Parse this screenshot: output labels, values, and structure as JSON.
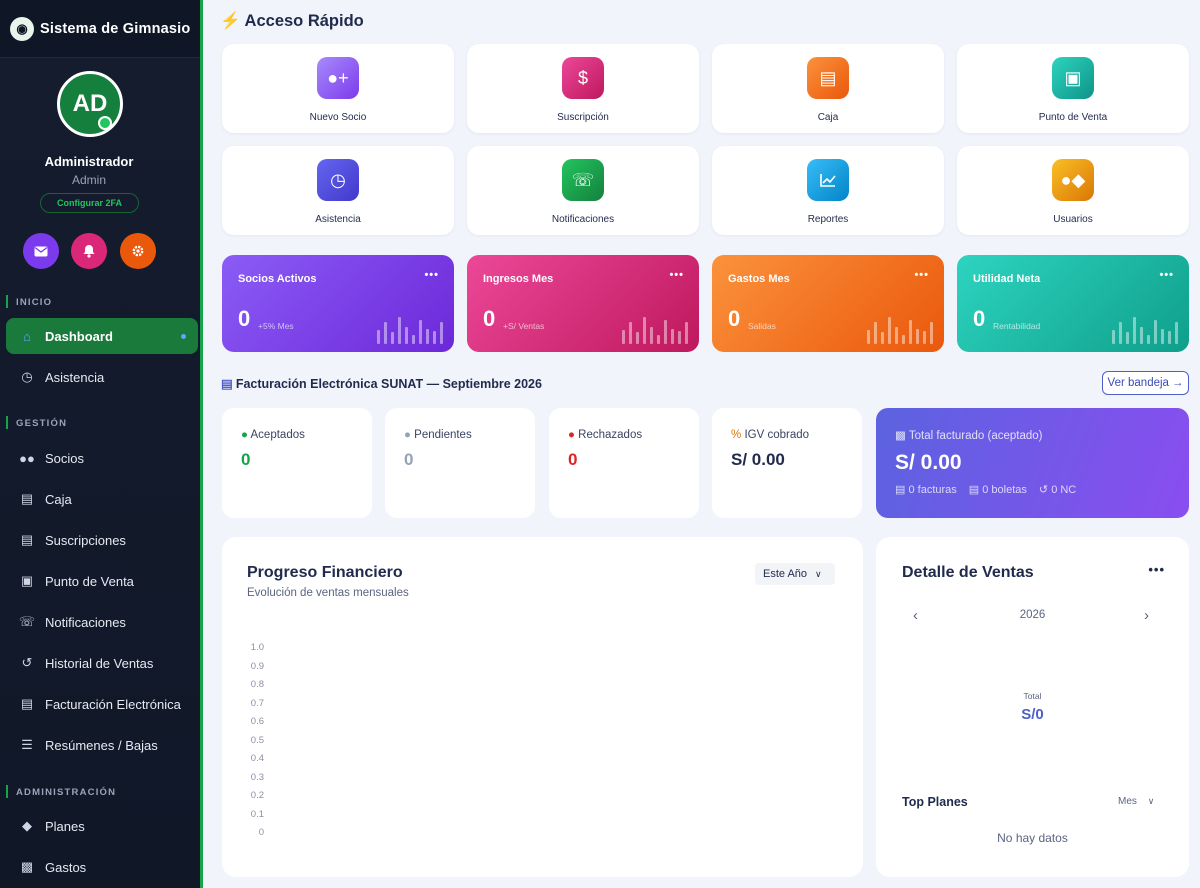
{
  "sidebar": {
    "app_name": "Sistema de Gimnasio",
    "logo_icon": "gym-logo-icon",
    "user": {
      "initials": "AD",
      "name": "Administrador",
      "role": "Admin",
      "twofa_label": "Configurar 2FA"
    },
    "quick_icons": [
      {
        "icon": "mail-icon",
        "color": "#7c3aed"
      },
      {
        "icon": "bell-icon",
        "color": "#db2777"
      },
      {
        "icon": "gear-icon",
        "color": "#ea580c"
      }
    ],
    "sections": {
      "inicio": "INICIO",
      "gestion": "GESTIÓN",
      "administracion": "ADMINISTRACIÓN"
    },
    "items": [
      {
        "label": "Dashboard",
        "icon": "home-icon",
        "active": true
      },
      {
        "label": "Asistencia",
        "icon": "clock-icon"
      },
      {
        "label": "Socios",
        "icon": "users-icon"
      },
      {
        "label": "Caja",
        "icon": "cash-register-icon"
      },
      {
        "label": "Suscripciones",
        "icon": "invoice-icon"
      },
      {
        "label": "Punto de Venta",
        "icon": "cart-icon"
      },
      {
        "label": "Notificaciones",
        "icon": "whatsapp-icon"
      },
      {
        "label": "Historial de Ventas",
        "icon": "history-icon"
      },
      {
        "label": "Facturación Electrónica",
        "icon": "document-icon"
      },
      {
        "label": "Resúmenes / Bajas",
        "icon": "layers-icon"
      },
      {
        "label": "Planes",
        "icon": "tag-icon"
      },
      {
        "label": "Gastos",
        "icon": "money-icon"
      }
    ]
  },
  "header": {
    "title": "Acceso Rápido"
  },
  "quick_access": [
    {
      "label": "Nuevo Socio",
      "icon": "user-plus-icon",
      "color": "#8b5cf6"
    },
    {
      "label": "Suscripción",
      "icon": "invoice-icon",
      "color": "#db2777"
    },
    {
      "label": "Caja",
      "icon": "cash-register-icon",
      "color": "#ea580c"
    },
    {
      "label": "Punto de Venta",
      "icon": "cart-icon",
      "color": "#14b8a6"
    },
    {
      "label": "Asistencia",
      "icon": "clock-icon",
      "color": "#4f46e5"
    },
    {
      "label": "Notificaciones",
      "icon": "whatsapp-icon",
      "color": "#16a34a"
    },
    {
      "label": "Reportes",
      "icon": "chart-line-icon",
      "color": "#0ea5e9"
    },
    {
      "label": "Usuarios",
      "icon": "user-shield-icon",
      "color": "#f59e0b"
    }
  ],
  "stats": [
    {
      "title": "Socios Activos",
      "value": "0",
      "sub": "+5% Mes",
      "bg": "#7c3aed"
    },
    {
      "title": "Ingresos Mes",
      "value": "0",
      "sub": "+S/ Ventas",
      "bg": "#db2777"
    },
    {
      "title": "Gastos Mes",
      "value": "0",
      "sub": "Salidas",
      "bg": "#f97316"
    },
    {
      "title": "Utilidad Neta",
      "value": "0",
      "sub": "Rentabilidad",
      "bg": "#14b8a6"
    }
  ],
  "facturacion": {
    "title": "Facturación Electrónica SUNAT — Septiembre 2026",
    "button": "Ver bandeja",
    "cards": [
      {
        "label": "Aceptados",
        "value": "0",
        "icon": "check-circle-icon",
        "color": "#16a34a"
      },
      {
        "label": "Pendientes",
        "value": "0",
        "icon": "clock-icon",
        "color": "#94a3b8"
      },
      {
        "label": "Rechazados",
        "value": "0",
        "icon": "x-circle-icon",
        "color": "#dc2626"
      },
      {
        "label": "IGV cobrado",
        "value": "S/ 0.00",
        "icon": "percent-icon",
        "color": "#1f2a4d"
      }
    ],
    "total": {
      "label": "Total facturado (aceptado)",
      "value": "S/ 0.00",
      "facturas": "0 facturas",
      "boletas": "0 boletas",
      "nc": "0 NC"
    }
  },
  "progress": {
    "title": "Progreso Financiero",
    "subtitle": "Evolución de ventas mensuales",
    "period": "Este Año"
  },
  "chart_data": {
    "type": "line",
    "title": "Progreso Financiero",
    "y_ticks": [
      "1.0",
      "0.9",
      "0.8",
      "0.7",
      "0.6",
      "0.5",
      "0.4",
      "0.3",
      "0.2",
      "0.1",
      "0"
    ],
    "ylim": [
      0,
      1
    ],
    "series": []
  },
  "detalle": {
    "title": "Detalle de Ventas",
    "year": "2026",
    "total_label": "Total",
    "total_value": "S/0",
    "top_title": "Top Planes",
    "top_period": "Mes",
    "empty": "No hay datos"
  }
}
